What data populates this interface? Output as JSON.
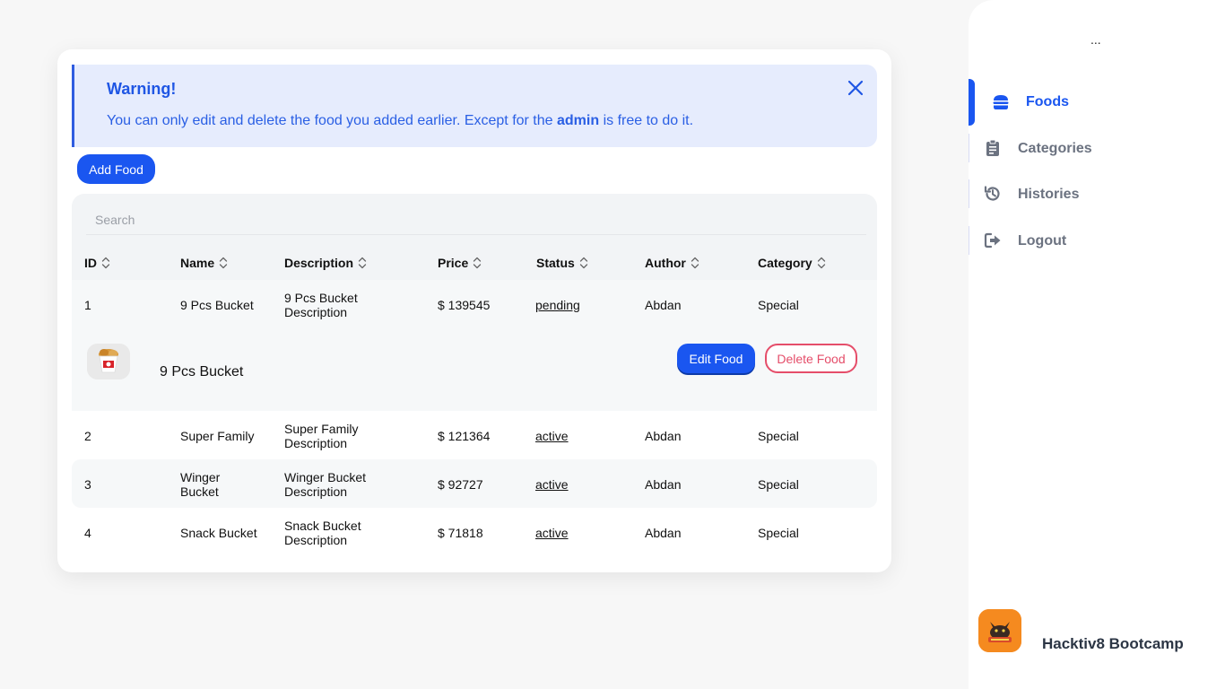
{
  "alert": {
    "title": "Warning!",
    "text_before": "You can only edit and delete the food you added earlier. Except for the ",
    "text_bold": "admin",
    "text_after": " is free to do it."
  },
  "toolbar": {
    "add_label": "Add Food"
  },
  "search": {
    "placeholder": "Search"
  },
  "table": {
    "columns": [
      "ID",
      "Name",
      "Description",
      "Price",
      "Status",
      "Author",
      "Category"
    ],
    "rows": [
      {
        "id": "1",
        "name": "9 Pcs Bucket",
        "desc_line1": "9 Pcs Bucket",
        "desc_line2": "Description",
        "price": "$ 139545",
        "status": "pending",
        "author": "Abdan",
        "category": "Special"
      },
      {
        "id": "2",
        "name": "Super Family",
        "desc_line1": "Super Family",
        "desc_line2": "Description",
        "price": "$ 121364",
        "status": "active",
        "author": "Abdan",
        "category": "Special"
      },
      {
        "id": "3",
        "name": "Winger Bucket",
        "desc_line1": "Winger Bucket",
        "desc_line2": "Description",
        "price": "$ 92727",
        "status": "active",
        "author": "Abdan",
        "category": "Special"
      },
      {
        "id": "4",
        "name": "Snack Bucket",
        "desc_line1": "Snack Bucket",
        "desc_line2": "Description",
        "price": "$ 71818",
        "status": "active",
        "author": "Abdan",
        "category": "Special"
      }
    ],
    "expanded": {
      "name": "9 Pcs Bucket",
      "edit_label": "Edit Food",
      "delete_label": "Delete Food"
    }
  },
  "sidebar": {
    "menu_dots": "...",
    "items": [
      {
        "label": "Foods",
        "icon": "burger-icon",
        "active": true
      },
      {
        "label": "Categories",
        "icon": "clipboard-icon",
        "active": false
      },
      {
        "label": "Histories",
        "icon": "history-icon",
        "active": false
      },
      {
        "label": "Logout",
        "icon": "logout-icon",
        "active": false
      }
    ],
    "brand": {
      "name": "Hacktiv8 Bootcamp"
    }
  },
  "colors": {
    "primary": "#1a56f0",
    "danger": "#e54e6a",
    "alert_bg": "#e6ecfd",
    "brand_orange": "#f58a1f"
  }
}
